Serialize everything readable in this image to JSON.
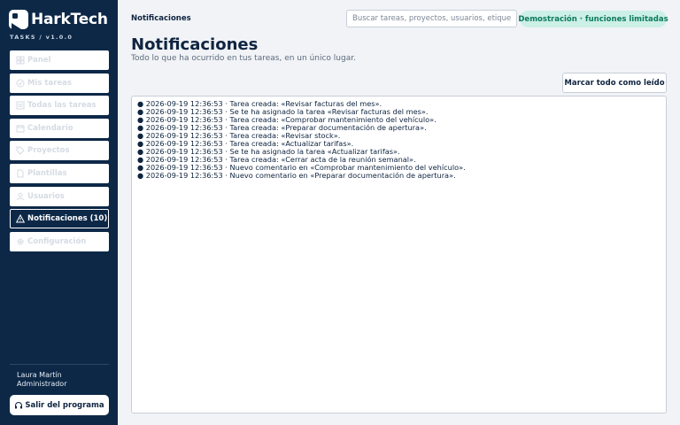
{
  "brand": {
    "name": "HarkTech",
    "sub": "TASKS  /  v1.0.0"
  },
  "sidebar": {
    "items": [
      {
        "label": "Panel",
        "icon": "grid-icon"
      },
      {
        "label": "Mis tareas",
        "icon": "check-circle-icon"
      },
      {
        "label": "Todas las tareas",
        "icon": "list-icon"
      },
      {
        "label": "Calendario",
        "icon": "calendar-icon"
      },
      {
        "label": "Proyectos",
        "icon": "tag-icon"
      },
      {
        "label": "Plantillas",
        "icon": "document-icon"
      },
      {
        "label": "Usuarios",
        "icon": "user-icon"
      },
      {
        "label": "Notificaciones  (10)",
        "icon": "warning-icon",
        "active": true
      },
      {
        "label": "Configuración",
        "icon": "gear-icon"
      }
    ],
    "user": {
      "name": "Laura Martín",
      "role": "Administrador"
    },
    "logout_label": "Salir del programa"
  },
  "topbar": {
    "breadcrumb": "Notificaciones",
    "search_placeholder": "Buscar tareas, proyectos, usuarios, etiquetas...",
    "demo_badge": "Demostración · funciones limitadas"
  },
  "main": {
    "title": "Notificaciones",
    "subtitle": "Todo lo que ha ocurrido en tus tareas, en un único lugar.",
    "mark_all_label": "Marcar todo como leído",
    "notifications": [
      "● 2026-09-19 12:36:53 · Tarea creada: «Revisar facturas del mes».",
      "● 2026-09-19 12:36:53 · Se te ha asignado la tarea «Revisar facturas del mes».",
      "● 2026-09-19 12:36:53 · Tarea creada: «Comprobar mantenimiento del vehículo».",
      "● 2026-09-19 12:36:53 · Tarea creada: «Preparar documentación de apertura».",
      "● 2026-09-19 12:36:53 · Tarea creada: «Revisar stock».",
      "● 2026-09-19 12:36:53 · Tarea creada: «Actualizar tarifas».",
      "● 2026-09-19 12:36:53 · Se te ha asignado la tarea «Actualizar tarifas».",
      "● 2026-09-19 12:36:53 · Tarea creada: «Cerrar acta de la reunión semanal».",
      "● 2026-09-19 12:36:53 · Nuevo comentario en «Comprobar mantenimiento del vehículo».",
      "● 2026-09-19 12:36:53 · Nuevo comentario en «Preparar documentación de apertura»."
    ]
  },
  "colors": {
    "sidebar": "#0d2847",
    "accent": "#0d7a5e",
    "badge_bg": "#ccf0e6"
  }
}
